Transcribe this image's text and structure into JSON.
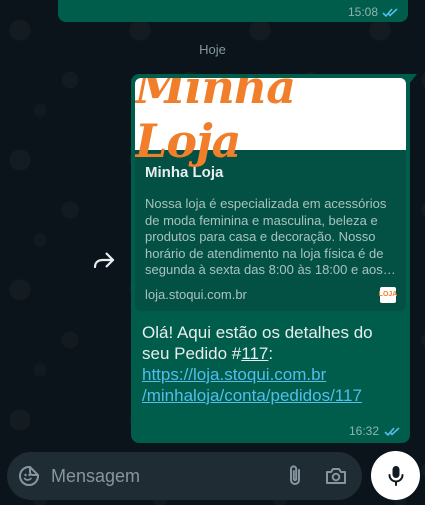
{
  "previous_message": {
    "time": "15:08",
    "status_icon": "double-check-read-icon"
  },
  "date_chip": "Hoje",
  "message": {
    "preview": {
      "image_text": "Minha Loja",
      "title": "Minha Loja",
      "description": "Nossa loja é especializada em acessórios de moda feminina e masculina, beleza e produtos para casa e decoração. Nosso horário de atendimento na loja física é de segunda à sexta das 8:00 às 18:00 e aos sábad…",
      "domain": "loja.stoqui.com.br",
      "favicon_text": "LOJA"
    },
    "text_intro": "Olá! Aqui estão os detalhes do seu Pedido #",
    "order_number": "117",
    "text_colon": ":",
    "link_line1": "https://loja.stoqui.com.br",
    "link_line2": "/minhaloja/conta/pedidos/117",
    "time": "16:32",
    "status_icon": "double-check-read-icon"
  },
  "input": {
    "placeholder": "Mensagem"
  },
  "icons": {
    "forward": "forward-icon",
    "emoji": "emoji-sticker-icon",
    "attach": "paperclip-icon",
    "camera": "camera-icon",
    "mic": "microphone-icon"
  },
  "colors": {
    "background": "#0b141a",
    "bubble_outgoing": "#005c4b",
    "link": "#53bdeb",
    "read_ticks": "#53bdeb",
    "input_bar": "#1f2c34",
    "logo_orange": "#f07e2a"
  }
}
